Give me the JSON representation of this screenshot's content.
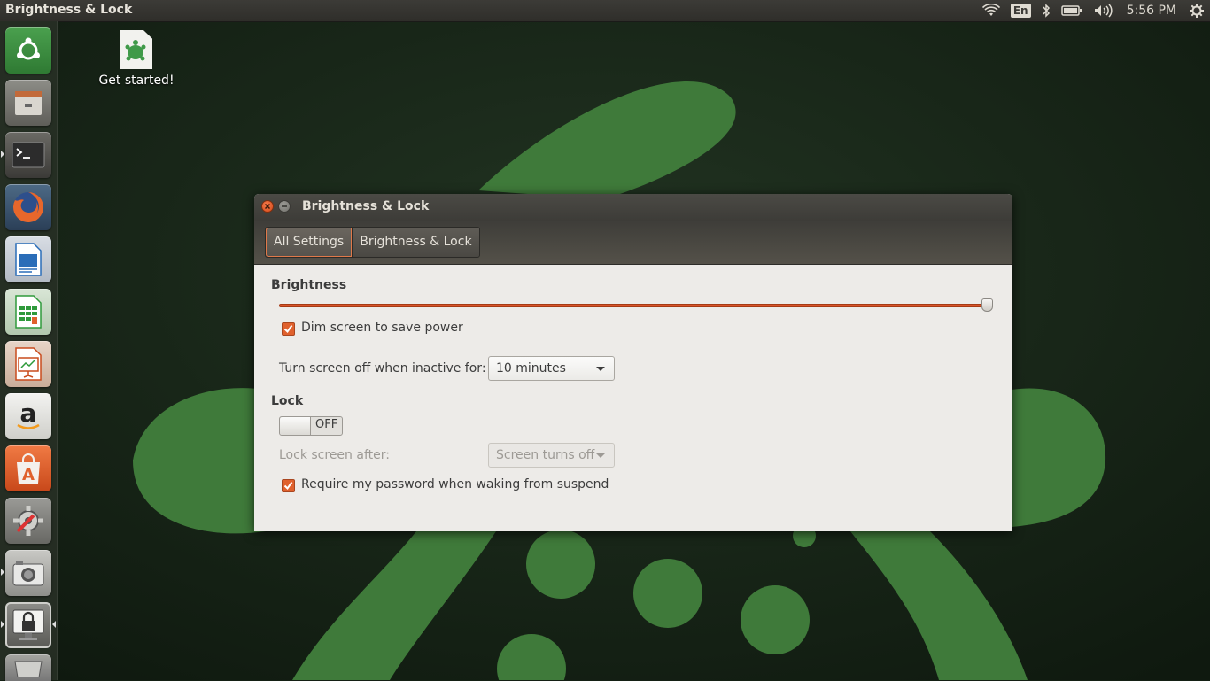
{
  "panel": {
    "title": "Brightness & Lock",
    "ghost_title": "Brightness & Lock",
    "language": "En",
    "clock": "5:56 PM"
  },
  "launcher": {
    "items": [
      {
        "name": "dash-home-icon",
        "color": "#3a8a3e"
      },
      {
        "name": "files-icon",
        "color": "#a08060"
      },
      {
        "name": "terminal-icon",
        "color": "#2b2b2b"
      },
      {
        "name": "firefox-icon",
        "color": "#e8672b"
      },
      {
        "name": "writer-icon",
        "color": "#2a6db8"
      },
      {
        "name": "calc-icon",
        "color": "#2f9a3b"
      },
      {
        "name": "impress-icon",
        "color": "#c94b1d"
      },
      {
        "name": "amazon-icon",
        "color": "#dcdcdc"
      },
      {
        "name": "software-center-icon",
        "color": "#e25a22"
      },
      {
        "name": "system-settings-icon",
        "color": "#8a8a8a"
      },
      {
        "name": "camera-icon",
        "color": "#9a9a9a"
      },
      {
        "name": "brightness-lock-icon",
        "color": "#777777"
      },
      {
        "name": "trash-icon",
        "color": "#999999"
      }
    ]
  },
  "desktop": {
    "icon_label": "Get started!"
  },
  "window": {
    "title": "Brightness & Lock",
    "breadcrumbs": [
      "All Settings",
      "Brightness & Lock"
    ],
    "brightness": {
      "heading": "Brightness",
      "level_percent": 100,
      "dim_label": "Dim screen to save power",
      "dim_checked": true,
      "screen_off_label": "Turn screen off when inactive for:",
      "screen_off_value": "10 minutes"
    },
    "lock": {
      "heading": "Lock",
      "switch_state": "OFF",
      "lock_after_label": "Lock screen after:",
      "lock_after_value": "Screen turns off",
      "password_label": "Require my password when waking from suspend",
      "password_checked": true
    }
  },
  "colors": {
    "accent": "#dd4814",
    "panel": "#3c3b37",
    "wallpaper_dark": "#1b2a1b",
    "wallpaper_green": "#3f7a3a"
  }
}
